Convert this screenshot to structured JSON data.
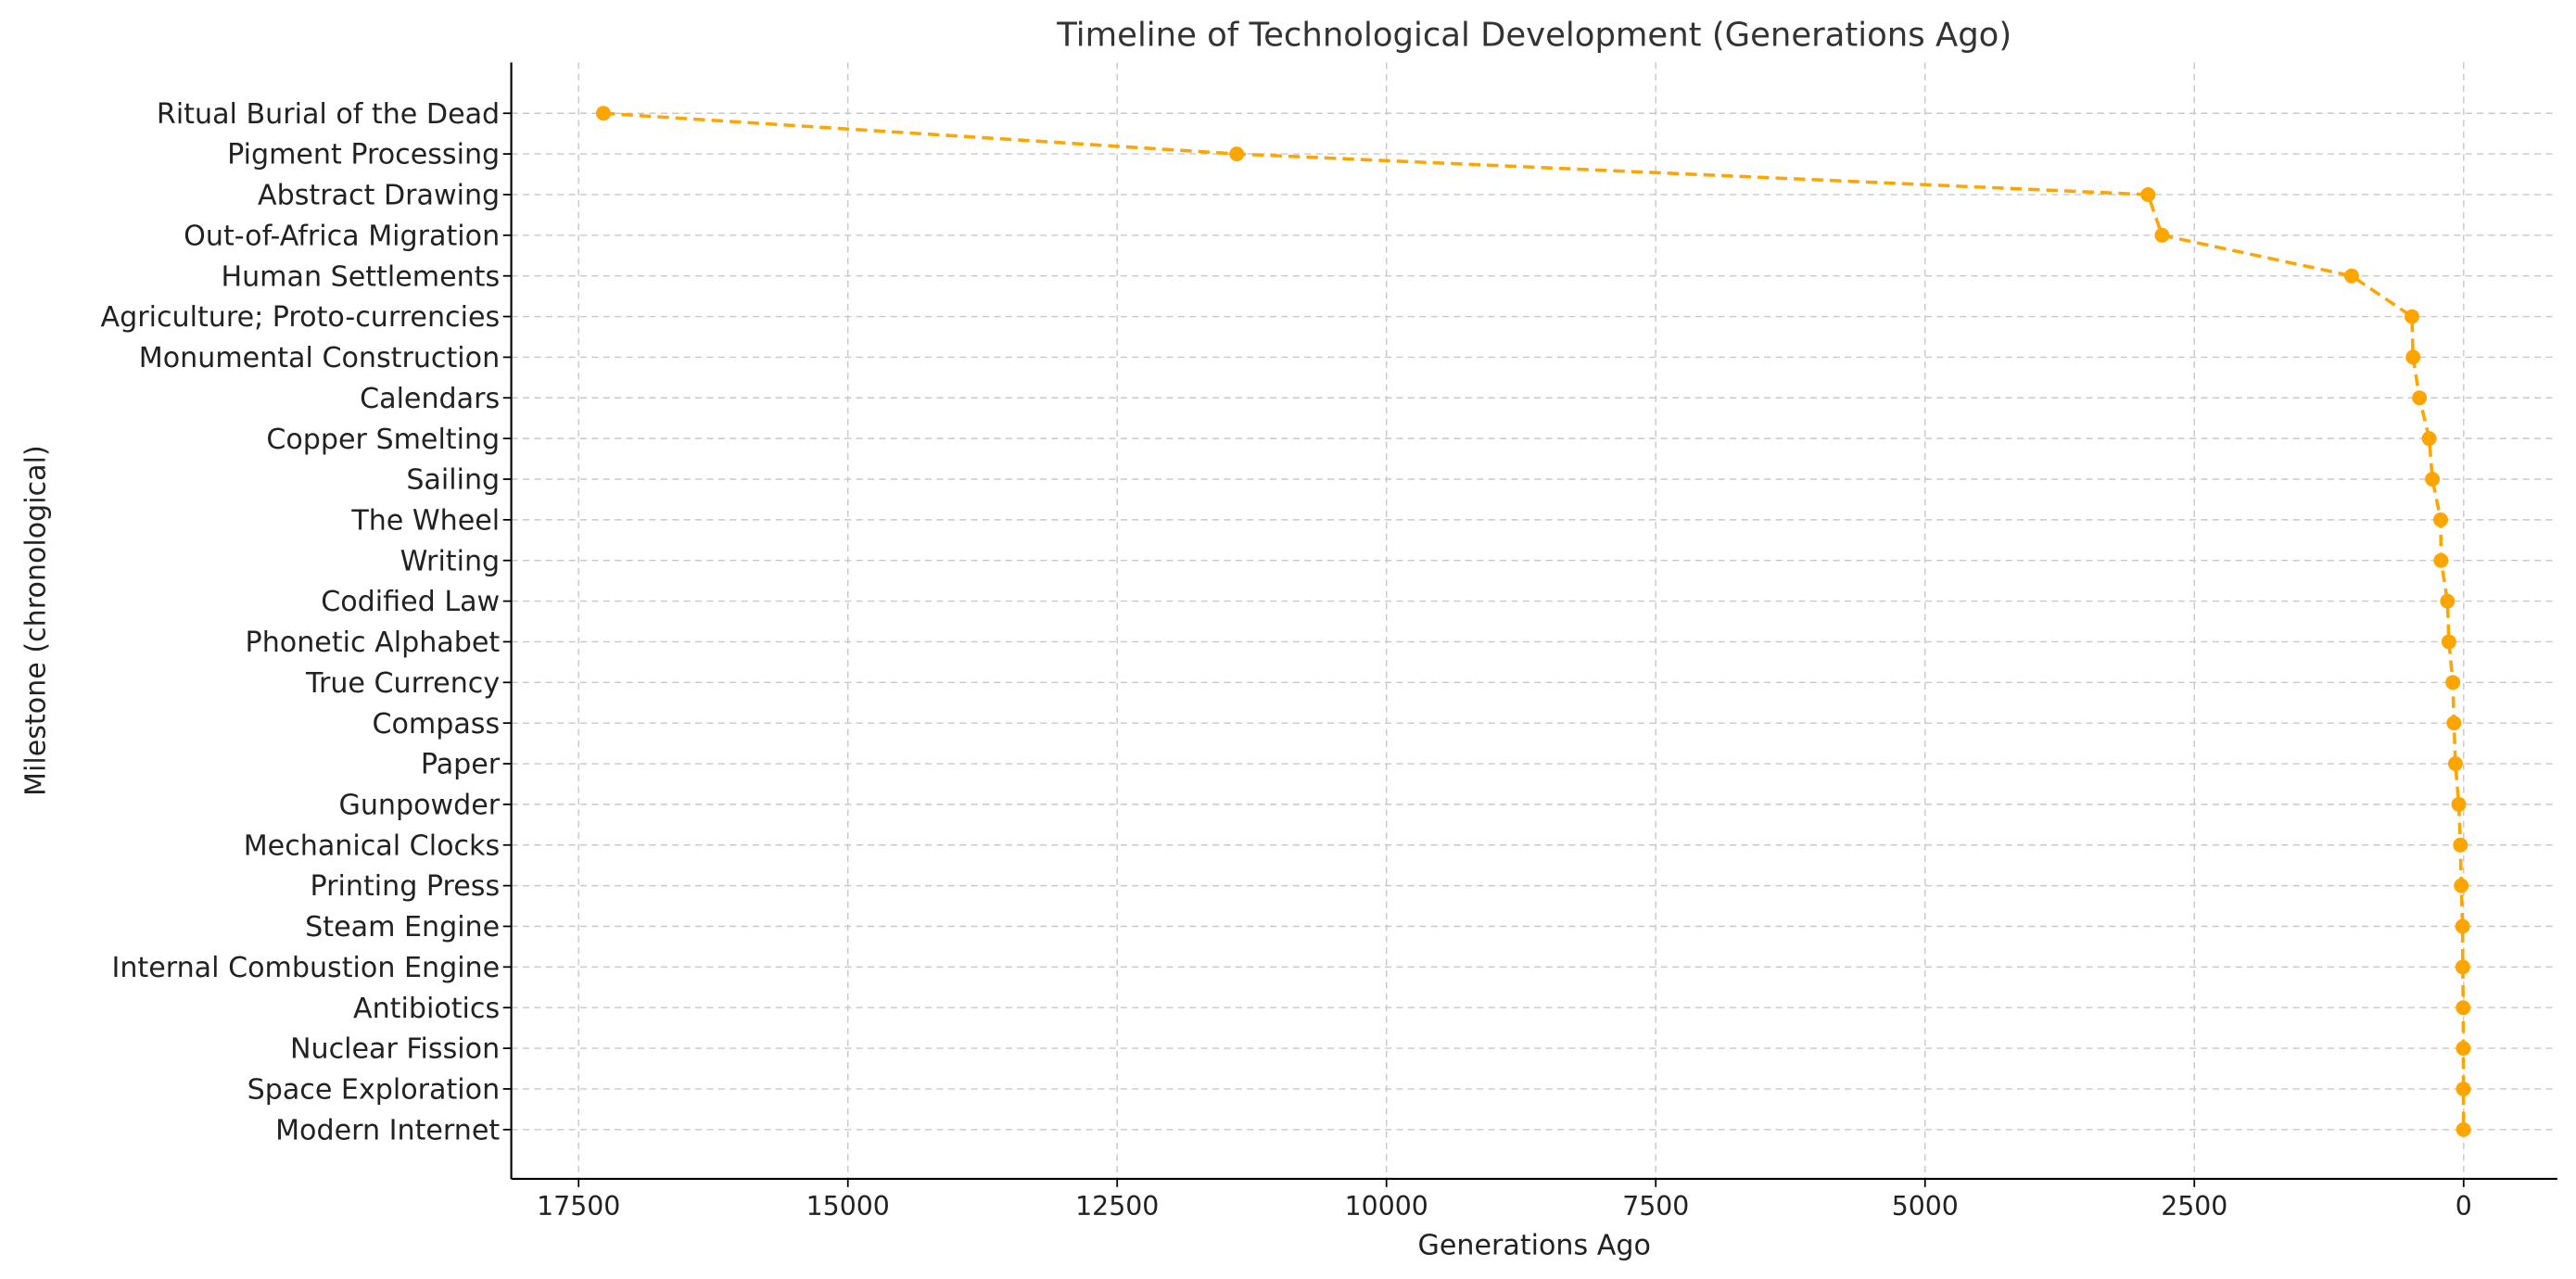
{
  "chart_data": {
    "type": "line",
    "title": "Timeline of Technological Development (Generations Ago)",
    "xlabel": "Generations Ago",
    "ylabel": "Milestone (chronological)",
    "xlim": [
      18125,
      -870
    ],
    "x_inverted": true,
    "xticks": [
      17500,
      15000,
      12500,
      10000,
      7500,
      5000,
      2500,
      0
    ],
    "grid": true,
    "line_style": "dashed",
    "marker": "circle",
    "color": "#FFA500",
    "categories": [
      "Ritual Burial of the Dead",
      "Pigment Processing",
      "Abstract Drawing",
      "Out-of-Africa Migration",
      "Human Settlements",
      "Agriculture; Proto-currencies",
      "Monumental Construction",
      "Calendars",
      "Copper Smelting",
      "Sailing",
      "The Wheel",
      "Writing",
      "Codified Law",
      "Phonetic Alphabet",
      "True Currency",
      "Compass",
      "Paper",
      "Gunpowder",
      "Mechanical Clocks",
      "Printing Press",
      "Steam Engine",
      "Internal Combustion Engine",
      "Antibiotics",
      "Nuclear Fission",
      "Space Exploration",
      "Modern Internet"
    ],
    "values": [
      17270,
      11390,
      2930,
      2800,
      1040,
      480,
      470,
      410,
      320,
      290,
      213,
      210,
      150,
      137,
      100,
      90,
      76,
      45,
      30,
      22,
      10,
      8,
      4,
      3,
      2,
      1
    ]
  }
}
